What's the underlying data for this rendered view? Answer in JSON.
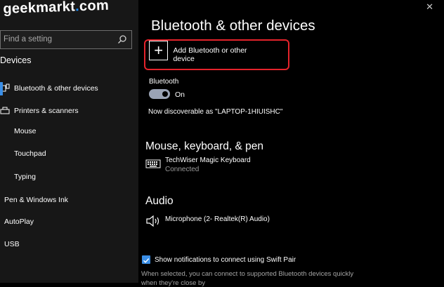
{
  "watermark": {
    "pre": "g",
    "mid": "eekmarkt",
    "post": "com"
  },
  "search": {
    "placeholder": "Find a setting"
  },
  "sidebar": {
    "section_title": "Devices",
    "items": [
      {
        "label": "Bluetooth & other devices",
        "icon": "bluetooth-icon"
      },
      {
        "label": "Printers & scanners",
        "icon": "printer-icon"
      },
      {
        "label": "Mouse",
        "icon": "mouse-icon"
      },
      {
        "label": "Touchpad",
        "icon": "touchpad-icon"
      },
      {
        "label": "Typing",
        "icon": "keyboard-icon"
      },
      {
        "label": "Pen & Windows Ink",
        "icon": "pen-icon"
      },
      {
        "label": "AutoPlay",
        "icon": "autoplay-icon"
      },
      {
        "label": "USB",
        "icon": "usb-icon"
      }
    ]
  },
  "window": {
    "close": "✕"
  },
  "main": {
    "title": "Bluetooth & other devices",
    "add_device_label": "Add Bluetooth or other device",
    "bluetooth_label": "Bluetooth",
    "toggle_state": "On",
    "discoverable": "Now discoverable as \"LAPTOP-1HIUISHC\"",
    "mouse_section": "Mouse, keyboard, & pen",
    "keyboard_name": "TechWiser Magic Keyboard",
    "keyboard_status": "Connected",
    "audio_section": "Audio",
    "mic_name": "Microphone (2- Realtek(R) Audio)",
    "swift_pair_label": "Show notifications to connect using Swift Pair",
    "swift_pair_note": "When selected, you can connect to supported Bluetooth devices quickly",
    "swift_pair_note2": "when they're close by"
  },
  "colors": {
    "accent": "#3a8ee6",
    "highlight": "#e4232b",
    "background": "#000000",
    "sidebar": "#171717"
  }
}
